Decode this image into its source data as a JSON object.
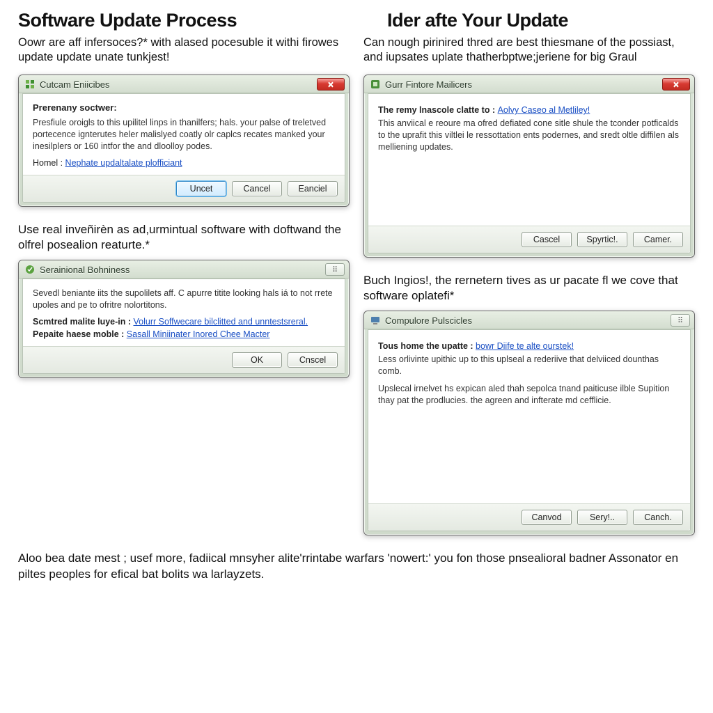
{
  "left": {
    "heading": "Software Update Process",
    "intro": "Oowr are aff infersoces?* with alased pocesuble it withi firowes update update unate tunkjest!",
    "mid": "Use real inveñirèn as ad,urmintual software with doftwand the olfrel posealion reaturte.*"
  },
  "right": {
    "heading": "Ider afte Your Update",
    "intro": "Can nough pirinired thred are best thiesmane of the possiast, and iupsates uplate thatherbptwe;jeriene for big Graul",
    "mid": "Buch Ingios!, the rernetern tives as ur pacate fl we cove that software oplatefi*"
  },
  "footer": "Aloo bea date mest ; usef more, fadiical mnsyher alite'rrintabe warfars 'nowert:' you fon those pnsealioral badner Assonator en piltes peoples for efical bat bolits wa larlayzets.",
  "dlg1": {
    "title": "Cutcam Eniicibes",
    "strong": "Prerenany soctwer:",
    "body": "Presfiule oroigls to this upilitel linps in thanilfers; hals. your palse of treletved portecence ignterutes heler malislyed coatly olr caplcs recates manked your inesilplers or 160 intfor the and dloolloy podes.",
    "linkLabel": "Homel : ",
    "link": "Nephate updaltalate plofficiant",
    "btnPrimary": "Uncet",
    "btn2": "Cancel",
    "btn3": "Eanciel"
  },
  "dlg2": {
    "title": "Gurr Fintore Mailicers",
    "linkLabel": "The remy lnascole clatte to : ",
    "link": "Aolvy Caseo al Metliley!",
    "body": "This anviical e reoure ma ofred defiated cone sitle shule the tconder potficalds to the uprafit this viltlei le ressottation ents podernes, and sredt oltle diffilen als melliening updates.",
    "btn1": "Cascel",
    "btn2": "Spyrtic!.",
    "btn3": "Camer."
  },
  "dlg3": {
    "title": "Serainional Bohniness",
    "body": "Sevedl beniante iits the supolilets aff. C apurre titite looking hals iá to not rrete upoles and pe to ofritre nolortitons.",
    "linkLabel1": "Scmtred malite luye-in : ",
    "link1": "Volurr Soffwecare bilclitted and unntestsreral.",
    "linkLabel2": "Pepaite haese moble : ",
    "link2": "Sasall Miniinater Inored Chee Macter",
    "btn1": "OK",
    "btn2": "Cnscel"
  },
  "dlg4": {
    "title": "Compulore Pulscicles",
    "linkLabel": "Tous home the upatte : ",
    "link": "bowr Diife te alte ourstek!",
    "body1": "Less orlivinte upithic up to this uplseal a rederiive that delviiced dounthas comb.",
    "body2": "Upslecal irnelvet hs expican aled thah sepolca tnand paiticuse ilble Supition thay pat the prodlucies. the agreen and infterate md cefflicie.",
    "btn1": "Canvod",
    "btn2": "Sery!..",
    "btn3": "Canch."
  },
  "icons": {
    "x": "✕",
    "dots": "⠿"
  }
}
